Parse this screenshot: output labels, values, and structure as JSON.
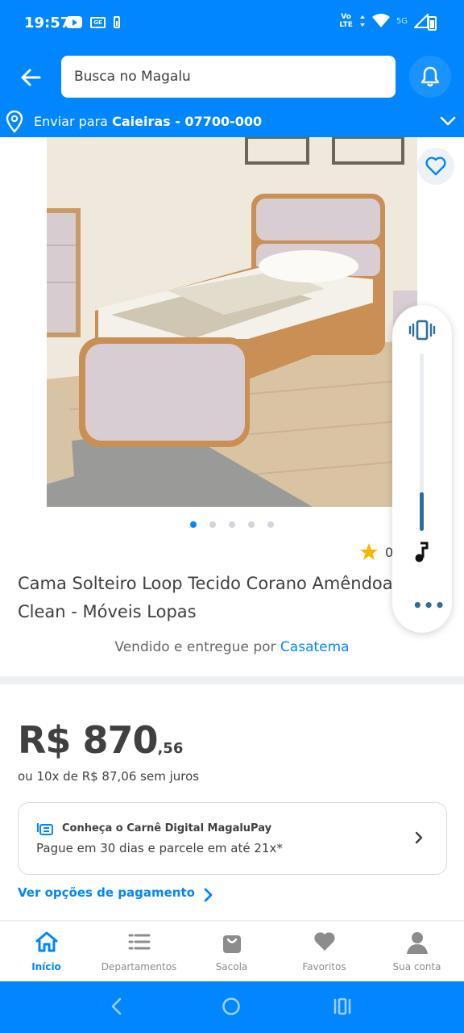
{
  "status_bar": {
    "time": "19:57",
    "notif_box_label": "GE",
    "volte_label": "Vo\nLTE",
    "network_label": "5G"
  },
  "header": {
    "search_placeholder": "Busca no Magalu",
    "delivery_prefix": "Enviar para",
    "delivery_location": "Caieiras - 07700-000"
  },
  "product": {
    "image_count": 5,
    "active_image_index": 0,
    "rating_text": "0 (0)",
    "title": "Cama Solteiro Loop Tecido Corano Amêndoa Clean - Móveis Lopas",
    "seller_prefix": "Vendido e entregue por",
    "seller_name": "Casatema"
  },
  "price": {
    "main": "R$ 870",
    "cents": ",56",
    "installments": "ou 10x de R$ 87,06 sem juros"
  },
  "carne": {
    "title": "Conheça o Carnê Digital MagaluPay",
    "subtitle": "Pague em 30 dias e parcele em até 21x*"
  },
  "payment_link": "Ver opções de pagamento",
  "volume": {
    "level": 0.22
  },
  "bottom_nav": [
    {
      "label": "Início",
      "icon": "home-icon",
      "active": true
    },
    {
      "label": "Departamentos",
      "icon": "menu-list-icon",
      "active": false
    },
    {
      "label": "Sacola",
      "icon": "bag-icon",
      "active": false
    },
    {
      "label": "Favoritos",
      "icon": "heart-icon",
      "active": false
    },
    {
      "label": "Sua conta",
      "icon": "user-icon",
      "active": false
    }
  ],
  "colors": {
    "brand_blue": "#0086FF",
    "text_dark": "#404040",
    "star": "#F5B800"
  }
}
